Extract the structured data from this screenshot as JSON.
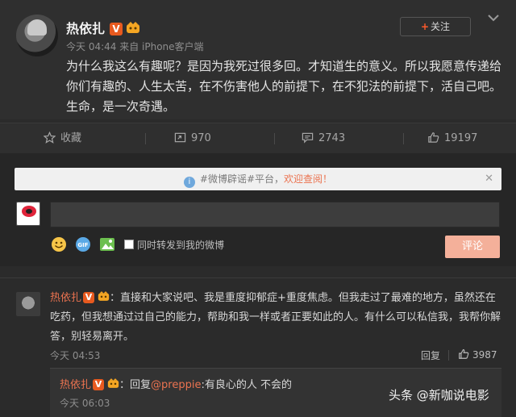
{
  "post": {
    "username": "热依扎",
    "verified_badge": "V",
    "meta": "今天 04:44 来自 iPhone客户端",
    "follow_label": "关注",
    "text": "为什么我这么有趣呢？是因为我死过很多回。才知道生的意义。所以我愿意传递给你们有趣的、人生太苦，在不伤害他人的前提下，在不犯法的前提下，活自己吧。生命，是一次奇遇。"
  },
  "actions": {
    "favorite_label": "收藏",
    "repost_count": "970",
    "comment_count": "2743",
    "like_count": "19197"
  },
  "composer": {
    "notice_prefix": "#微博辟谣#平台，",
    "notice_link": "欢迎查阅！",
    "input_value": "",
    "also_repost_label": "同时转发到我的微博",
    "submit_label": "评论"
  },
  "comment": {
    "author": "热依扎",
    "verified_badge": "V",
    "text": "：直接和大家说吧、我是重度抑郁症+重度焦虑。但我走过了最难的地方，虽然还在吃药，但我想通过过自己的能力，帮助和我一样或者正要如此的人。有什么可以私信我，我帮你解答，别轻易离开。",
    "time": "今天 04:53",
    "reply_label": "回复",
    "like_count": "3987",
    "sub_reply": {
      "author": "热依扎",
      "verified_badge": "V",
      "prefix": "：回复",
      "mention": "@preppie",
      "text": ":有良心的人 不会的",
      "time": "今天 06:03"
    }
  },
  "watermark": "头条 @新咖说电影",
  "colors": {
    "accent": "#eb7350",
    "vip_badge": "#e85a1f",
    "background": "#2b2b2b"
  },
  "icons": [
    "chevron-down-icon",
    "star-icon",
    "repost-icon",
    "comment-icon",
    "thumbs-up-icon",
    "emoji-icon",
    "gif-icon",
    "image-icon",
    "info-icon",
    "close-icon",
    "crown-icon"
  ]
}
